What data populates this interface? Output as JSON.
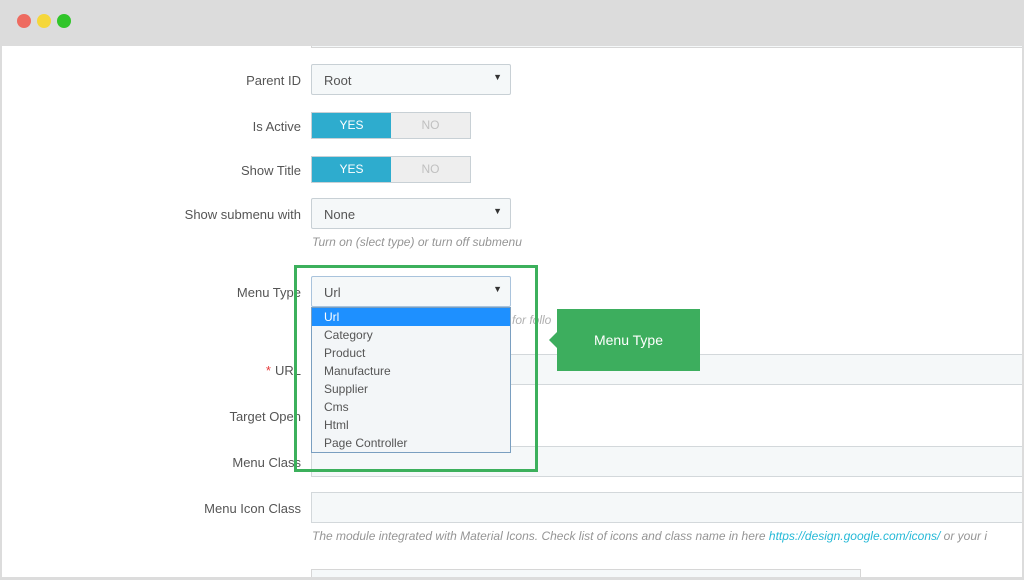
{
  "window": {
    "controls": [
      "close-dot",
      "minimize-dot",
      "maximize-dot"
    ]
  },
  "form": {
    "parent_id": {
      "label": "Parent ID",
      "value": "Root"
    },
    "is_active": {
      "label": "Is Active",
      "yes": "YES",
      "no": "NO"
    },
    "show_title": {
      "label": "Show Title",
      "yes": "YES",
      "no": "NO"
    },
    "show_submenu": {
      "label": "Show submenu with",
      "value": "None",
      "help": "Turn on (slect type) or turn off submenu"
    },
    "menu_type": {
      "label": "Menu Type",
      "value": "Url",
      "options": [
        "Url",
        "Category",
        "Product",
        "Manufacture",
        "Supplier",
        "Cms",
        "Html",
        "Page Controller"
      ],
      "help_fragment": "for follo"
    },
    "url": {
      "label": "URL",
      "required_mark": "*"
    },
    "target_open": {
      "label": "Target Open"
    },
    "menu_class": {
      "label": "Menu Class"
    },
    "menu_icon_class": {
      "label": "Menu Icon Class",
      "help_prefix": "The module integrated with Material Icons. Check list of icons and class name in here ",
      "help_link": "https://design.google.com/icons/",
      "help_suffix": " or your i"
    }
  },
  "callout": {
    "text": "Menu Type"
  },
  "colors": {
    "accent": "#2eacce",
    "highlight": "#3cb05c",
    "selection": "#1e90ff"
  }
}
